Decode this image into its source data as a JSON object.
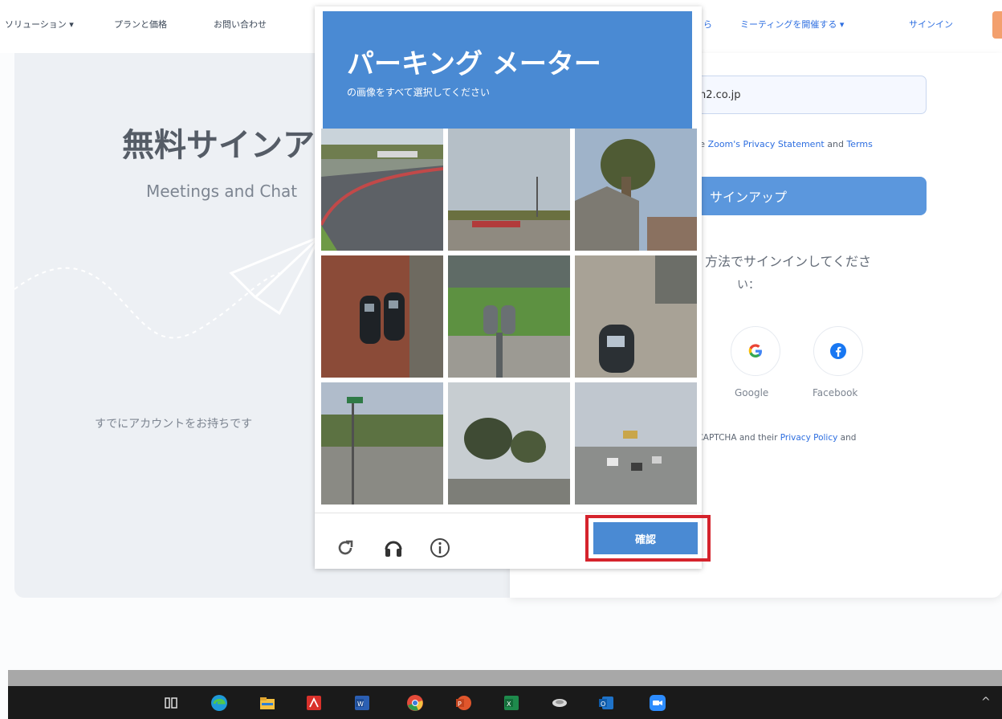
{
  "nav": {
    "items": [
      "ソリューション ▾",
      "プランと価格",
      "お問い合わせ"
    ],
    "right_items": [
      "ら",
      "ミーティングを開催する ▾",
      "サインイン"
    ]
  },
  "left": {
    "title": "無料サインア",
    "subtitle": "Meetings and Chat",
    "already": "すでにアカウントをお持ちです"
  },
  "right": {
    "email_value": "n2.co.jp",
    "terms_prefix": "the",
    "terms_link1": "Zoom's Privacy Statement",
    "terms_mid": "and",
    "terms_link2": "Terms",
    "signup_label": "サインアップ",
    "other_line1": "方法でサインインしてくださ",
    "other_line2": "い：",
    "google_label": "Google",
    "facebook_label": "Facebook",
    "recaptcha_prefix": "eCAPTCHA and their",
    "recaptcha_link": "Privacy Policy",
    "recaptcha_suffix": "and"
  },
  "captcha": {
    "title": "パーキング メーター",
    "instruction": "の画像をすべて選択してください",
    "verify_label": "確認",
    "icons": [
      "refresh-icon",
      "headphones-icon",
      "info-icon"
    ]
  },
  "taskbar": {
    "icons": [
      "task-view-icon",
      "edge-icon",
      "file-explorer-icon",
      "acrobat-icon",
      "word-icon",
      "chrome-icon",
      "powerpoint-icon",
      "excel-icon",
      "app-icon",
      "outlook-icon",
      "zoom-icon"
    ],
    "caret": "^"
  },
  "colors": {
    "captcha_blue": "#4a8ad3",
    "signup_blue": "#5b97dd",
    "highlight_red": "#d5232c",
    "link_blue": "#2d6ee0"
  }
}
